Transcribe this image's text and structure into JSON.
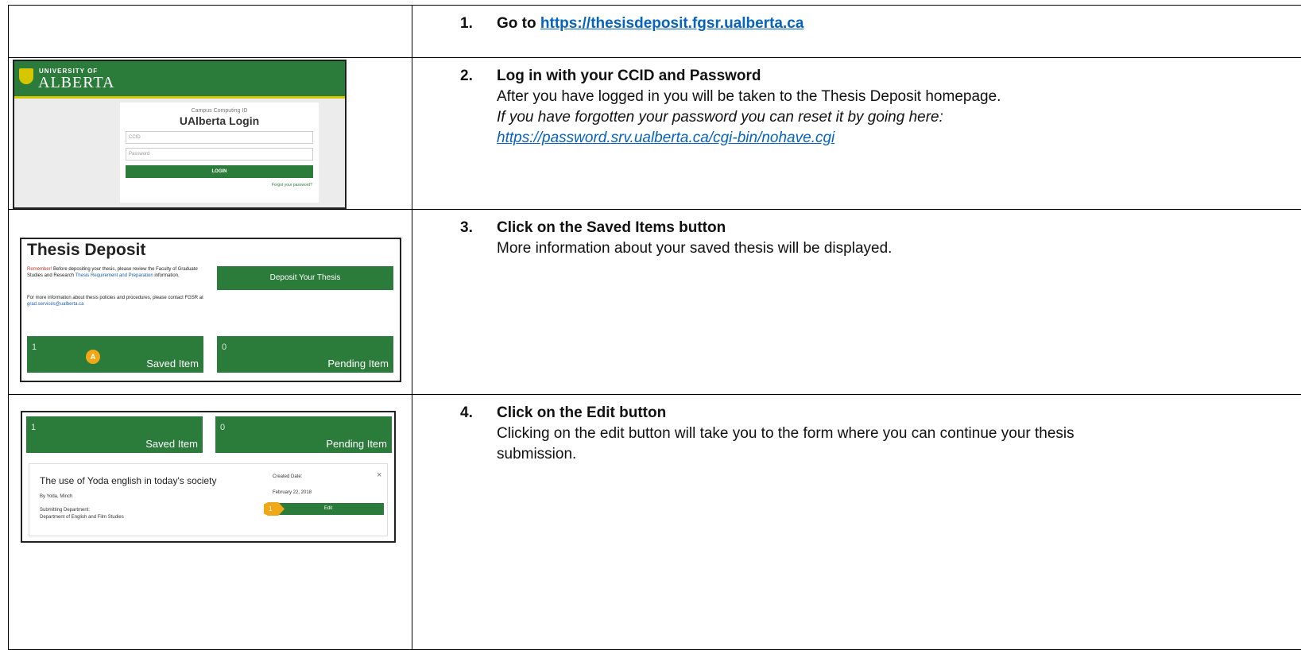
{
  "steps": [
    {
      "number": "1.",
      "heading_prefix": "Go to ",
      "heading_link": "https://thesisdeposit.fgsr.ualberta.ca"
    },
    {
      "number": "2.",
      "heading": "Log in with your CCID and Password",
      "line1": "After you have logged in you will be taken to the Thesis Deposit homepage.",
      "line2": "If you have forgotten your password you can reset it by going here:",
      "link": "https://password.srv.ualberta.ca/cgi-bin/nohave.cgi"
    },
    {
      "number": "3.",
      "heading": "Click on the Saved Items button",
      "line1": "More information about your saved thesis will be displayed."
    },
    {
      "number": "4.",
      "heading": "Click on the Edit button",
      "line1": "Clicking on the edit button will take you to the form where you can continue your thesis",
      "line2": "submission."
    }
  ],
  "login_screen": {
    "logo_small": "UNIVERSITY OF",
    "logo_big": "ALBERTA",
    "caption": "Campus Computing ID",
    "title": "UAlberta Login",
    "ccid_placeholder": "CCID",
    "password_placeholder": "Password",
    "login_button": "LOGIN",
    "forgot_link": "Forgot your password?"
  },
  "deposit_screen": {
    "title": "Thesis Deposit",
    "remember": "Remember!",
    "para1a": " Before depositing your thesis, please review the Faculty of Graduate Studies and Research ",
    "para1_link": "Thesis Requirement and Preparation",
    "para1b": " information.",
    "para2a": "For more information about thesis policies and procedures, please contact FGSR at ",
    "para2_link": "grad.services@ualberta.ca",
    "deposit_button": "Deposit Your Thesis",
    "saved_count": "1",
    "saved_label": "Saved Item",
    "pending_count": "0",
    "pending_label": "Pending Item",
    "marker": "A"
  },
  "saved_screen": {
    "saved_count": "1",
    "saved_label": "Saved Item",
    "pending_count": "0",
    "pending_label": "Pending Item",
    "item_title": "The use of Yoda english in today's society",
    "item_by": "By Yoda, Minch",
    "dept_label": "Submitting Department:",
    "dept_value": "Department of English and Film Studies",
    "created_label": "Created Date:",
    "created_value": "February 22, 2018",
    "edit_button": "Edit",
    "close_glyph": "×",
    "marker": "1"
  }
}
